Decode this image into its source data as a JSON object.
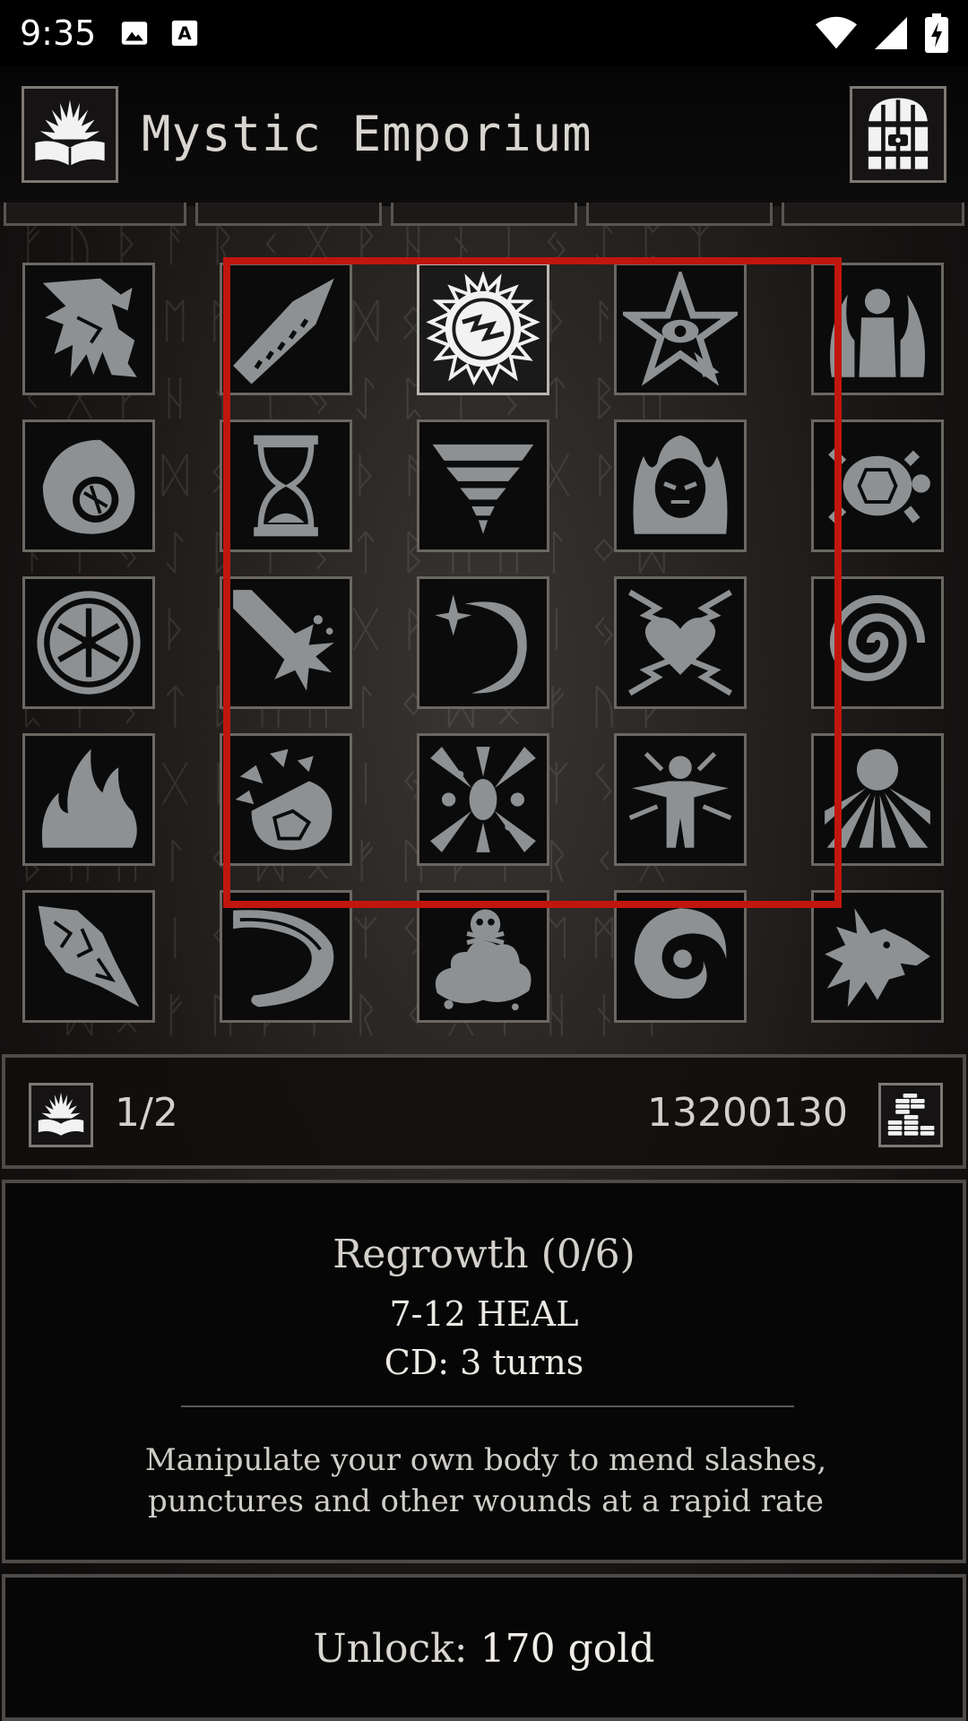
{
  "status_bar": {
    "time": "9:35",
    "left_icons": [
      "image-icon",
      "font-download-icon"
    ],
    "right_icons": [
      "wifi-icon",
      "signal-icon",
      "battery-charging-icon"
    ]
  },
  "header": {
    "title": "Mystic Emporium",
    "left_button_icon": "spellbook-icon",
    "right_button_icon": "door-exit-icon"
  },
  "skills": [
    {
      "name": "lightning-bolt-icon",
      "selected": false
    },
    {
      "name": "rune-sword-icon",
      "selected": false
    },
    {
      "name": "regrowth-orb-icon",
      "selected": true
    },
    {
      "name": "pentagram-eye-icon",
      "selected": false
    },
    {
      "name": "flame-aura-figure-icon",
      "selected": false
    },
    {
      "name": "fireball-icon",
      "selected": false
    },
    {
      "name": "hourglass-icon",
      "selected": false
    },
    {
      "name": "tornado-icon",
      "selected": false
    },
    {
      "name": "burning-masked-head-icon",
      "selected": false
    },
    {
      "name": "turtle-shell-icon",
      "selected": false
    },
    {
      "name": "snowflake-shield-icon",
      "selected": false
    },
    {
      "name": "meteor-strike-icon",
      "selected": false
    },
    {
      "name": "crescent-moon-icon",
      "selected": false
    },
    {
      "name": "broken-heart-icon",
      "selected": false
    },
    {
      "name": "whirlwind-icon",
      "selected": false
    },
    {
      "name": "flames-icon",
      "selected": false
    },
    {
      "name": "shattered-orb-icon",
      "selected": false
    },
    {
      "name": "explosion-burst-icon",
      "selected": false
    },
    {
      "name": "radiant-figure-icon",
      "selected": false
    },
    {
      "name": "sunburst-icon",
      "selected": false
    },
    {
      "name": "ice-shards-icon",
      "selected": false
    },
    {
      "name": "wind-gust-icon",
      "selected": false
    },
    {
      "name": "poison-skull-cloud-icon",
      "selected": false
    },
    {
      "name": "vortex-icon",
      "selected": false
    },
    {
      "name": "wolf-head-icon",
      "selected": false
    }
  ],
  "info_bar": {
    "skill_points": "1/2",
    "gold": "13200130",
    "book_icon": "spellbook-icon",
    "gold_icon": "gold-coins-icon"
  },
  "detail": {
    "title": "Regrowth (0/6)",
    "stat_line": "7-12 HEAL",
    "cooldown_line": "CD: 3 turns",
    "description_line1": "Manipulate your own body to mend slashes,",
    "description_line2": "punctures and other wounds at a rapid rate"
  },
  "unlock": {
    "label": "Unlock:",
    "amount": "170 gold"
  },
  "colors": {
    "selection_frame": "#c0160e",
    "cell_border": "#6b6762",
    "icon_fill": "#8e9193",
    "selected_icon_fill": "#f2f2f2"
  }
}
